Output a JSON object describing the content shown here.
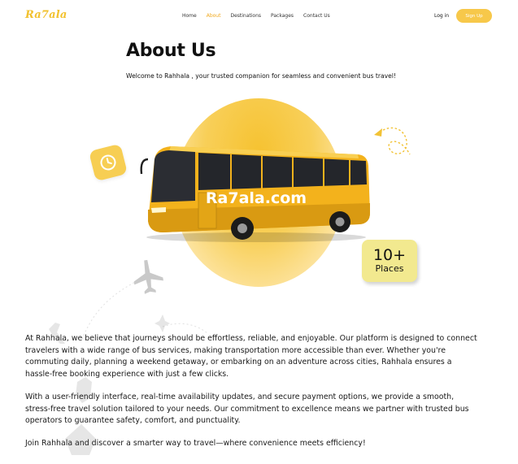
{
  "brand": {
    "logo": "Ra7ala"
  },
  "nav": {
    "items": [
      {
        "label": "Home",
        "active": false
      },
      {
        "label": "About",
        "active": true
      },
      {
        "label": "Destinations",
        "active": false
      },
      {
        "label": "Packages",
        "active": false
      },
      {
        "label": "Contact Us",
        "active": false
      }
    ],
    "login_label": "Log in",
    "signup_label": "Sign Up"
  },
  "header": {
    "title": "About Us",
    "subtitle": "Welcome to Rahhala , your trusted companion for seamless and convenient bus travel!"
  },
  "hero": {
    "bus_text": "Ra7ala.com",
    "badge_number": "10+",
    "badge_label": "Places",
    "icons": [
      "clock-icon",
      "airplane-icon",
      "dotted-arrow-icon"
    ]
  },
  "body": {
    "paragraphs": [
      "At Rahhala, we believe that journeys should be effortless, reliable, and enjoyable. Our platform is designed to connect travelers with a wide range of bus services, making transportation more accessible than ever. Whether you're commuting daily, planning a weekend getaway, or embarking on an adventure across cities, Rahhala ensures a hassle-free booking experience with just a few clicks.",
      "With a user-friendly interface, real-time availability updates, and secure payment options, we provide a smooth, stress-free travel solution tailored to your needs. Our commitment to excellence means we partner with trusted bus operators to guarantee safety, comfort, and punctuality.",
      "Join Rahhala and discover a smarter way to travel—where convenience meets efficiency!"
    ]
  },
  "colors": {
    "accent": "#f7c84a",
    "active_nav": "#f0a81c",
    "bus_body": "#f3b21c",
    "badge_bg": "#f2e98f"
  }
}
